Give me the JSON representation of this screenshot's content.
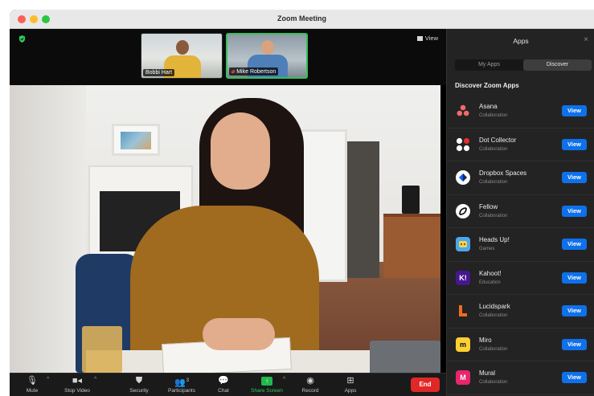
{
  "window": {
    "title": "Zoom Meeting"
  },
  "meeting": {
    "view_label": "View"
  },
  "participants": [
    {
      "name": "Bobbi Hart",
      "muted": false
    },
    {
      "name": "Mike Robertson",
      "muted": true
    }
  ],
  "toolbar": {
    "mute_label": "Mute",
    "stop_video_label": "Stop Video",
    "security_label": "Security",
    "participants_label": "Participants",
    "participants_count": "3",
    "chat_label": "Chat",
    "share_screen_label": "Share Screen",
    "record_label": "Record",
    "apps_label": "Apps",
    "end_label": "End"
  },
  "apps_panel": {
    "title": "Apps",
    "close_glyph": "×",
    "tabs": [
      "My Apps",
      "Discover"
    ],
    "active_tab": "Discover",
    "section_title": "Discover Zoom Apps",
    "view_label": "View",
    "apps": [
      {
        "name": "Asana",
        "category": "Collaboration",
        "icon": "asana-icon",
        "color": "#f06a6a"
      },
      {
        "name": "Dot Collector",
        "category": "Collaboration",
        "icon": "dot-collector-icon",
        "color": "#ffffff"
      },
      {
        "name": "Dropbox Spaces",
        "category": "Collaboration",
        "icon": "dropbox-spaces-icon",
        "color": "#0061fe"
      },
      {
        "name": "Fellow",
        "category": "Collaboration",
        "icon": "fellow-icon",
        "color": "#ffffff"
      },
      {
        "name": "Heads Up!",
        "category": "Games",
        "icon": "heads-up-icon",
        "color": "#4aa8f0"
      },
      {
        "name": "Kahoot!",
        "category": "Education",
        "icon": "kahoot-icon",
        "color": "#46178f"
      },
      {
        "name": "Lucidspark",
        "category": "Collaboration",
        "icon": "lucidspark-icon",
        "color": "#f26b1d"
      },
      {
        "name": "Miro",
        "category": "Collaboration",
        "icon": "miro-icon",
        "color": "#ffd02f"
      },
      {
        "name": "Mural",
        "category": "Collaboration",
        "icon": "mural-icon",
        "color": "#e8266b"
      }
    ]
  },
  "colors": {
    "accent_blue": "#0e71eb",
    "share_green": "#23b84a",
    "end_red": "#e02828",
    "active_speaker_border": "#35c15b"
  }
}
